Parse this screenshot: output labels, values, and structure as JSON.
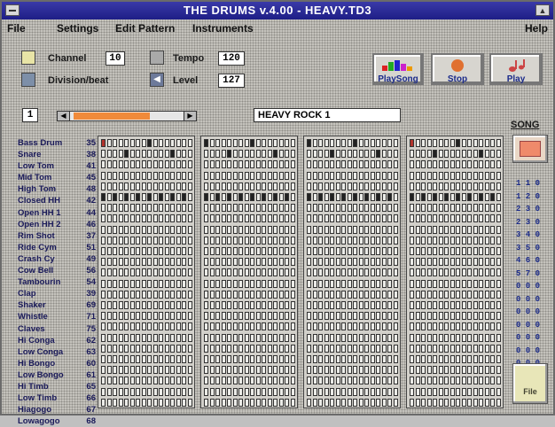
{
  "window": {
    "title": "THE DRUMS v.4.00 - HEAVY.TD3"
  },
  "menu": {
    "file": "File",
    "settings": "Settings",
    "edit_pattern": "Edit Pattern",
    "instruments": "Instruments",
    "help": "Help"
  },
  "controls": {
    "channel_label": "Channel",
    "channel_value": "10",
    "division_label": "Division/beat",
    "tempo_label": "Tempo",
    "tempo_value": "120",
    "level_label": "Level",
    "level_value": "127"
  },
  "buttons": {
    "play_song": "PlaySong",
    "stop": "Stop",
    "play": "Play"
  },
  "pattern": {
    "number": "1",
    "name": "HEAVY ROCK 1",
    "tempo_position": 0.72
  },
  "song_label": "SONG",
  "instruments": [
    {
      "name": "Bass Drum",
      "note": "35"
    },
    {
      "name": "Snare",
      "note": "38"
    },
    {
      "name": "Low Tom",
      "note": "41"
    },
    {
      "name": "Mid Tom",
      "note": "45"
    },
    {
      "name": "High Tom",
      "note": "48"
    },
    {
      "name": "Closed HH",
      "note": "42"
    },
    {
      "name": "Open HH 1",
      "note": "44"
    },
    {
      "name": "Open HH 2",
      "note": "46"
    },
    {
      "name": "Rim Shot",
      "note": "37"
    },
    {
      "name": "Ride Cym",
      "note": "51"
    },
    {
      "name": "Crash Cy",
      "note": "49"
    },
    {
      "name": "Cow Bell",
      "note": "56"
    },
    {
      "name": "Tambourin",
      "note": "54"
    },
    {
      "name": "Clap",
      "note": "39"
    },
    {
      "name": "Shaker",
      "note": "69"
    },
    {
      "name": "Whistle",
      "note": "71"
    },
    {
      "name": "Claves",
      "note": "75"
    },
    {
      "name": "Hi Conga",
      "note": "62"
    },
    {
      "name": "Low Conga",
      "note": "63"
    },
    {
      "name": "Hi Bongo",
      "note": "60"
    },
    {
      "name": "Low Bongo",
      "note": "61"
    },
    {
      "name": "Hi Timb",
      "note": "65"
    },
    {
      "name": "Low Timb",
      "note": "66"
    },
    {
      "name": "Hiagogo",
      "note": "67"
    },
    {
      "name": "Lowagogo",
      "note": "68"
    }
  ],
  "song_list": [
    "1 1 0",
    "1 2 0",
    "2 3 0",
    "2 3 0",
    "3 4 0",
    "3 5 0",
    "4 6 0",
    "5 7 0",
    "0 0 0",
    "0 0 0",
    "0 0 0",
    "0 0 0",
    "0 0 0",
    "0 0 0",
    "0 0 0",
    "0 0 0"
  ],
  "file_button": "File",
  "colors": {
    "title_bar": "#1e1e86",
    "slider_fill": "#f08a3a",
    "accent_label": "#1c2c8a"
  }
}
